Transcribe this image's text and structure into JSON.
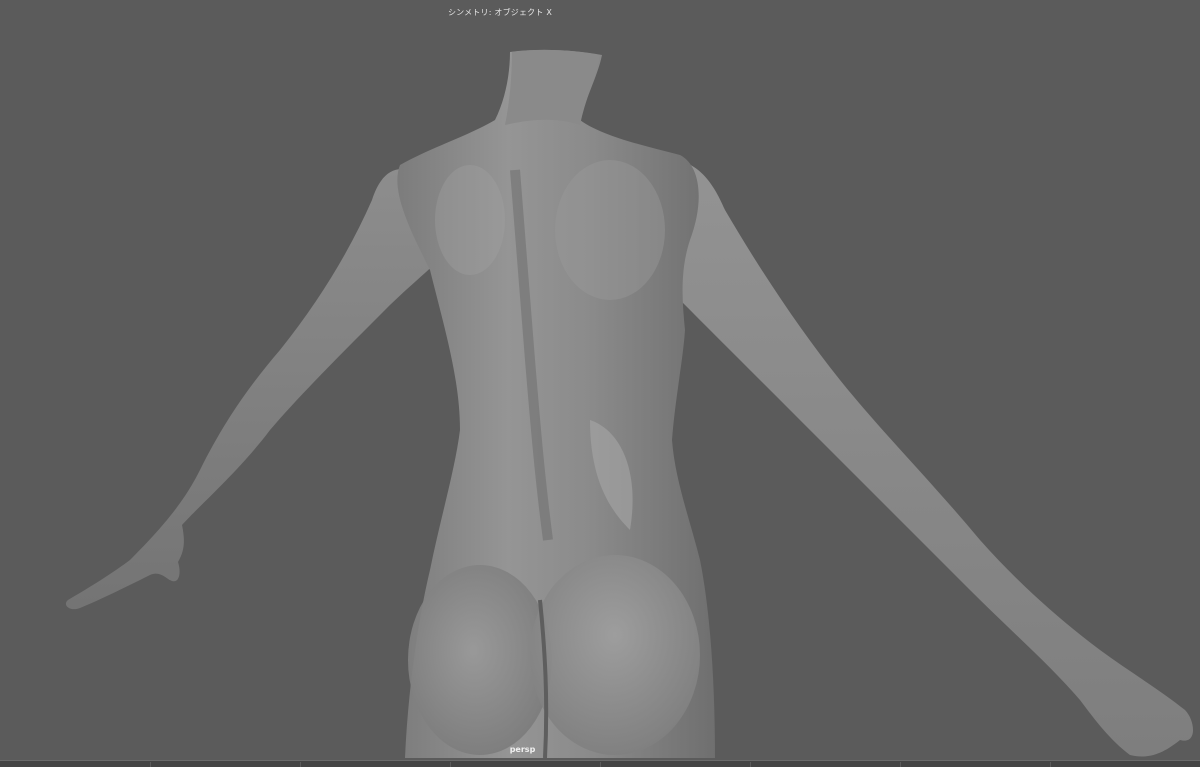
{
  "viewport": {
    "symmetry_label": "シンメトリ: オブジェクト X",
    "camera_label": "persp",
    "background_color": "#5b5b5b",
    "model": {
      "icon": "female-body-back-mesh",
      "surface_color": "#8e8e8e",
      "shadow_color": "#4a4a4a"
    }
  },
  "bottom_bar": {
    "color": "#444444"
  }
}
